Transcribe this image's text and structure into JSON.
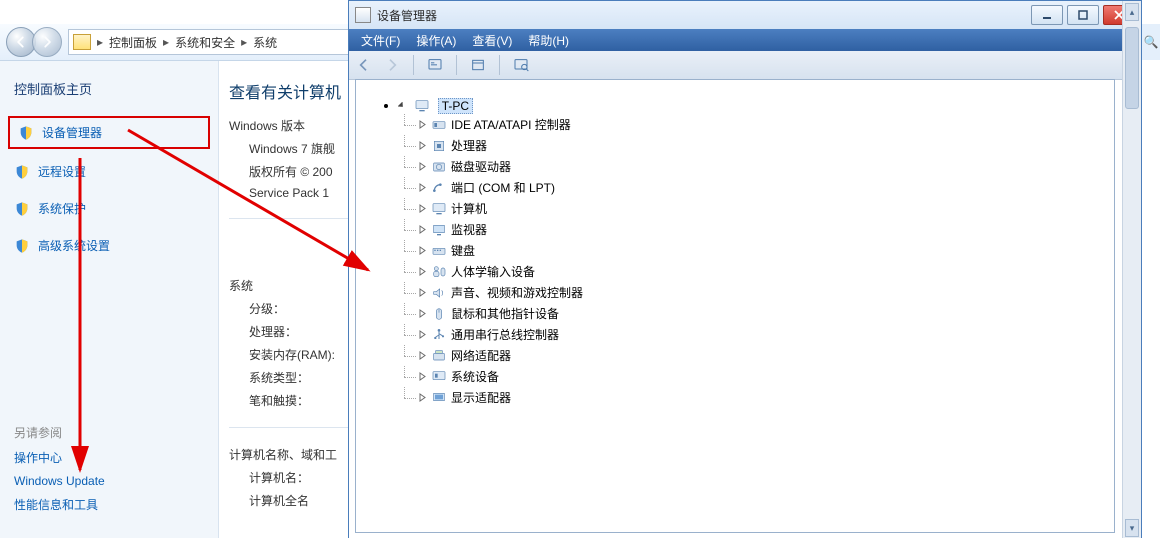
{
  "control_panel": {
    "breadcrumb": {
      "root": "控制面板",
      "sub1": "系统和安全",
      "sub2": "系统"
    },
    "sidebar": {
      "title": "控制面板主页",
      "links": [
        {
          "label": "设备管理器"
        },
        {
          "label": "远程设置"
        },
        {
          "label": "系统保护"
        },
        {
          "label": "高级系统设置"
        }
      ],
      "see_also_title": "另请参阅",
      "see_also": [
        {
          "label": "操作中心"
        },
        {
          "label": "Windows Update"
        },
        {
          "label": "性能信息和工具"
        }
      ]
    },
    "main": {
      "heading": "查看有关计算机",
      "section_edition": "Windows 版本",
      "line_edition1": "Windows 7 旗舰",
      "line_copyright": "版权所有 © 200",
      "line_sp": "Service Pack 1",
      "section_system": "系统",
      "row_rating": "分级：",
      "row_cpu": "处理器：",
      "row_ram": "安装内存(RAM):",
      "row_type": "系统类型：",
      "row_pentouch": "笔和触摸：",
      "section_name": "计算机名称、域和工",
      "row_compname": "计算机名：",
      "row_fullname_cut": "计算机全名"
    }
  },
  "device_manager": {
    "title": "设备管理器",
    "menubar": [
      {
        "label": "文件(F)"
      },
      {
        "label": "操作(A)"
      },
      {
        "label": "查看(V)"
      },
      {
        "label": "帮助(H)"
      }
    ],
    "root": "T-PC",
    "nodes": [
      {
        "label": "IDE ATA/ATAPI 控制器",
        "icon": "ide"
      },
      {
        "label": "处理器",
        "icon": "cpu"
      },
      {
        "label": "磁盘驱动器",
        "icon": "disk"
      },
      {
        "label": "端口 (COM 和 LPT)",
        "icon": "port"
      },
      {
        "label": "计算机",
        "icon": "computer"
      },
      {
        "label": "监视器",
        "icon": "monitor"
      },
      {
        "label": "键盘",
        "icon": "keyboard"
      },
      {
        "label": "人体学输入设备",
        "icon": "hid"
      },
      {
        "label": "声音、视频和游戏控制器",
        "icon": "sound"
      },
      {
        "label": "鼠标和其他指针设备",
        "icon": "mouse"
      },
      {
        "label": "通用串行总线控制器",
        "icon": "usb"
      },
      {
        "label": "网络适配器",
        "icon": "net"
      },
      {
        "label": "系统设备",
        "icon": "system"
      },
      {
        "label": "显示适配器",
        "icon": "display"
      }
    ]
  },
  "outer_right": {
    "search_cue": "🔍"
  }
}
